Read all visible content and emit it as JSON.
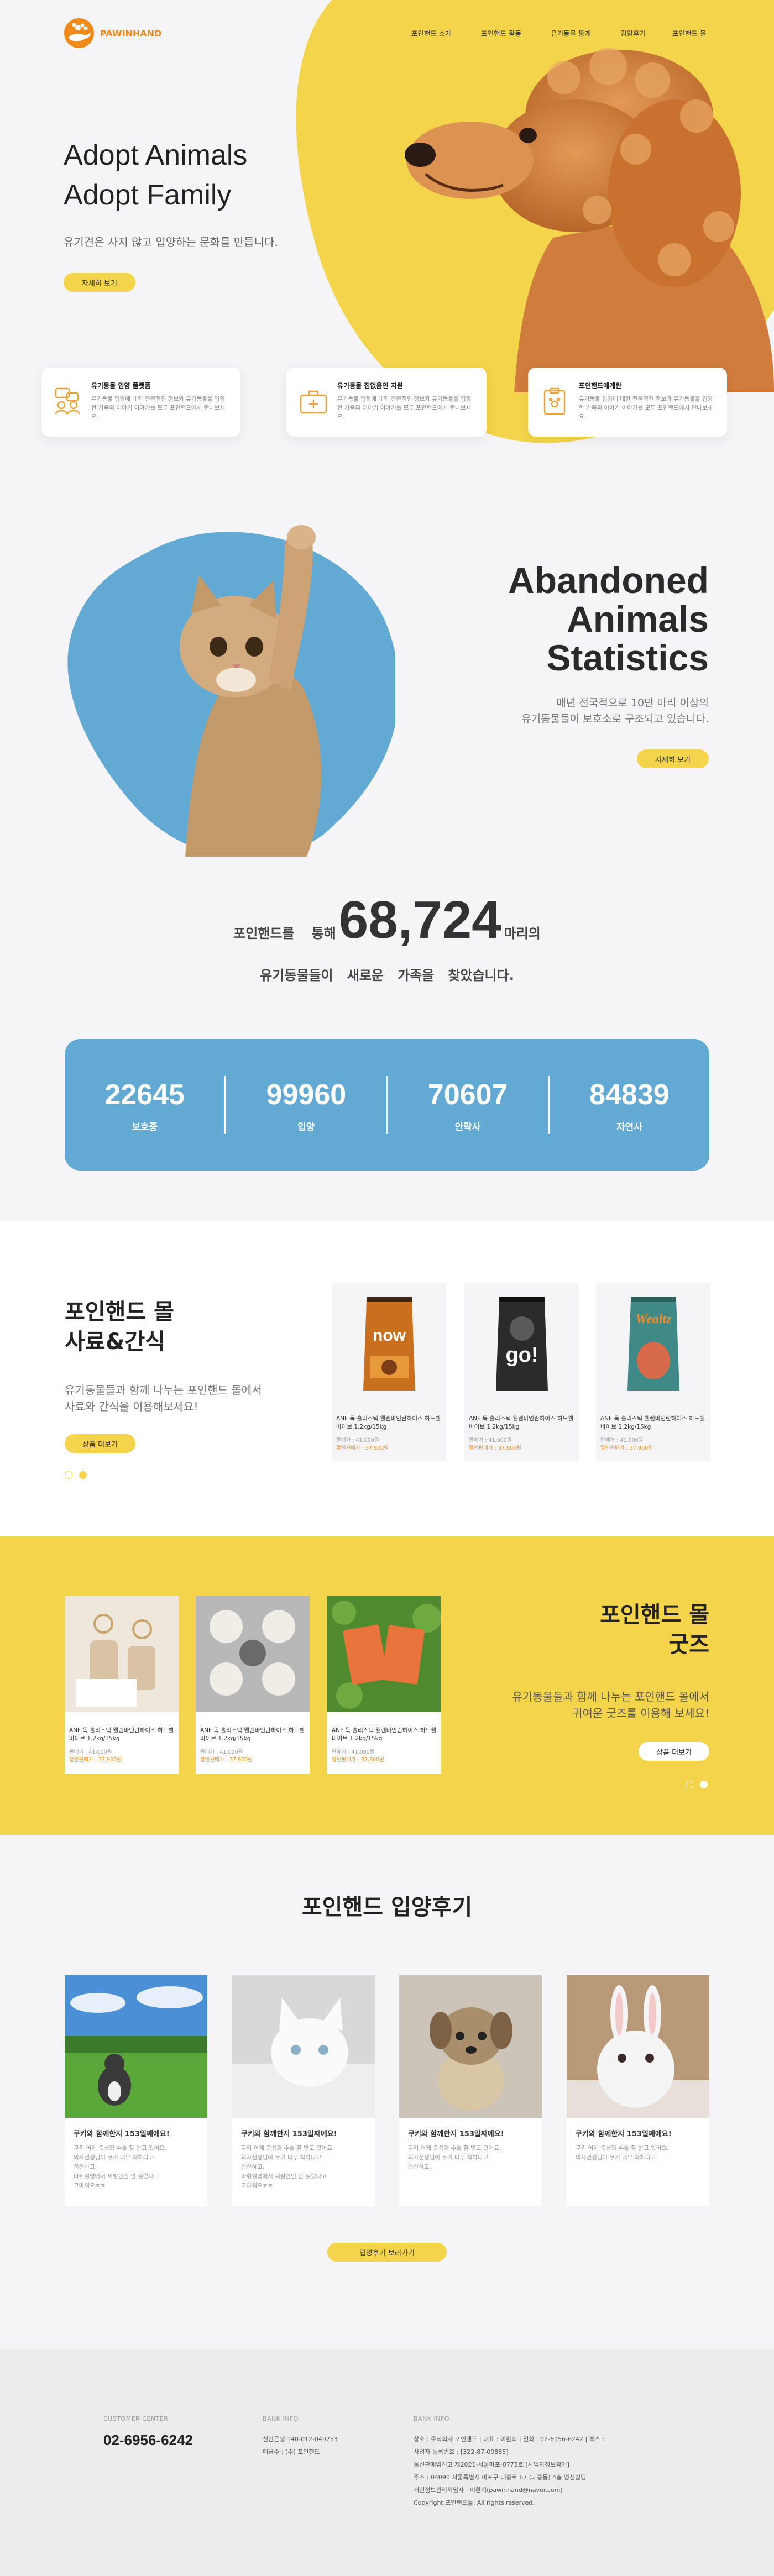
{
  "header": {
    "logo_text": "PAWINHAND",
    "nav": [
      "포인핸드 소개",
      "포인핸드 활동",
      "유기동물 통계",
      "입양후기",
      "포인핸드 몰"
    ]
  },
  "hero": {
    "title_line1": "Adopt Animals",
    "title_line2": "Adopt Family",
    "subtitle": "유기견은 사지 않고 입양하는 문화를 만듭니다.",
    "button": "자세히 보기"
  },
  "features": [
    {
      "title": "유기동물 입양 플랫폼",
      "desc": "유기동물 입양에 대한 전문적인 정보와 유기동물을 입양한 가족의 이야기 이야기를 모두 포인핸드에서 만나보세요.",
      "icon": "people-chat-icon"
    },
    {
      "title": "유기동물 집없음인 지원",
      "desc": "유기동물 입양에 대한 전문적인 정보와 유기동물을 입양한 가족의 이야기 이야기를 모두 포인핸드에서 만나보세요.",
      "icon": "medical-kit-icon"
    },
    {
      "title": "포인핸드에게란",
      "desc": "유기동물 입양에 대한 전문적인 정보와 유기동물을 입양한 가족의 이야기 이야기를 모두 포인핸드에서 만나보세요.",
      "icon": "document-paw-icon"
    }
  ],
  "stats": {
    "title_line1": "Abandoned",
    "title_line2": "Animals",
    "title_line3": "Statistics",
    "desc_line1": "매년 전국적으로 10만 마리 이상의",
    "desc_line2": "유기동물들이 보호소로 구조되고 있습니다.",
    "button": "자세히 보기",
    "count_prefix_1": "포인핸드를",
    "count_prefix_2": "통해",
    "count_number": "68,724",
    "count_suffix": "마리의",
    "count_line2": "유기동물들이   새로운   가족을   찾았습니다.",
    "boxes": [
      {
        "value": "22645",
        "label": "보호중"
      },
      {
        "value": "99960",
        "label": "입양"
      },
      {
        "value": "70607",
        "label": "안락사"
      },
      {
        "value": "84839",
        "label": "자연사"
      }
    ]
  },
  "mall_food": {
    "title_line1": "포인핸드 몰",
    "title_line2": "사료&간식",
    "desc_line1": "유기동물들과 함께 나누는 포인핸드 몰에서",
    "desc_line2": "사료와 간식을 이용해보세요!",
    "button": "상품 더보기",
    "products": [
      {
        "name": "ANF 독 홀리스틱 웰렌바인란하이스 하드쉘바이브 1.2kg/15kg",
        "meta": "판매가 : 41,000원",
        "price": "할인판매가 : 37,900원",
        "brand": "now",
        "bag_color": "#c9701f"
      },
      {
        "name": "ANF 독 홀리스틱 웰렌바인란하이스 하드쉘바이브 1.2kg/15kg",
        "meta": "판매가 : 41,000원",
        "price": "할인판매가 : 37,900원",
        "brand": "go!",
        "bag_color": "#2b2b2b"
      },
      {
        "name": "ANF 독 홀리스틱 웰렌바인란하이스 하드쉘바이브 1.2kg/15kg",
        "meta": "판매가 : 41,000원",
        "price": "할인판매가 : 37,900원",
        "brand": "Wealtz",
        "bag_color": "#3f8a86"
      }
    ]
  },
  "mall_goods": {
    "title_line1": "포인핸드 몰",
    "title_line2": "굿즈",
    "desc_line1": "유기동물들과 함께 나누는 포인핸드 몰에서",
    "desc_line2": "귀여운 굿즈를 이용해 보세요!",
    "button": "상품 더보기",
    "products": [
      {
        "name": "ANF 독 홀리스틱 웰렌바인란하이스 하드쉘바이브 1.2kg/15kg",
        "meta": "판매가 : 41,000원",
        "price": "할인판매가 : 37,900원"
      },
      {
        "name": "ANF 독 홀리스틱 웰렌바인란하이스 하드쉘바이브 1.2kg/15kg",
        "meta": "판매가 : 41,000원",
        "price": "할인판매가 : 37,900원"
      },
      {
        "name": "ANF 독 홀리스틱 웰렌바인란하이스 하드쉘바이브 1.2kg/15kg",
        "meta": "판매가 : 41,000원",
        "price": "할인판매가 : 37,900원"
      }
    ]
  },
  "reviews": {
    "title": "포인핸드 입양후기",
    "button": "입양후기 보러가기",
    "items": [
      {
        "title": "쿠키와 함께한지 153일째에요!",
        "line1": "쿠키 어제 중성화 수술 잘 받고 왔어요.",
        "line2": "의사선생님이 쿠키 너무 착하다고",
        "line3": "칭찬하고,",
        "line4": "마취설명에서 씨발한번 안 질렀다고",
        "line5": "고마워요ㅎㅎ"
      },
      {
        "title": "쿠키와 함께한지 153일째에요!",
        "line1": "쿠키 어제 중성화 수술 잘 받고 왔어요.",
        "line2": "의사선생님이 쿠키 너무 착하다고",
        "line3": "칭찬하고,",
        "line4": "마취설명에서 씨발한번 안 질렀다고",
        "line5": "고마워요ㅎㅎ"
      },
      {
        "title": "쿠키와 함께한지 153일째에요!",
        "line1": "쿠키 어제 중성화 수술 잘 받고 왔어요.",
        "line2": "의사선생님이 쿠키 너무 착하다고",
        "line3": "칭찬하고,",
        "line4": "",
        "line5": ""
      },
      {
        "title": "쿠키와 함께한지 153일째에요!",
        "line1": "쿠키 어제 중성화 수술 잘 받고 왔어요.",
        "line2": "의사선생님이 쿠키 너무 착하다고",
        "line3": "",
        "line4": "",
        "line5": ""
      }
    ]
  },
  "footer": {
    "cs_label": "CUSTOMER CENTER",
    "cs_phone": "02-6956-6242",
    "bank_label": "BANK INFO",
    "bank_line1": "신한은행 140-012-049753",
    "bank_line2": "예금주 : (주) 포인핸드",
    "info_label": "BANK INFO",
    "info_lines": [
      "상호 : 주식회사 포인핸드 | 대표 : 이환희 | 전화 : 02-6956-6242 | 팩스 :",
      "사업자 등록번호 : [322-87-00885]",
      "통신판매업신고 제2021-서울마포-0775호 [사업자정보확인]",
      "주소 : 04090 서울특별시 마포구 대흥로 67 (대흥동) 4층 영신빌딩",
      "개인정보관리책임자 : 이환희(pawinhand@naver.com)",
      "Copyright 포인핸드몰. All rights reserved."
    ]
  },
  "colors": {
    "accent_yellow": "#f3d44a",
    "accent_blue": "#62a9d4",
    "logo_orange": "#f08a1c",
    "price_orange": "#f0901c"
  }
}
